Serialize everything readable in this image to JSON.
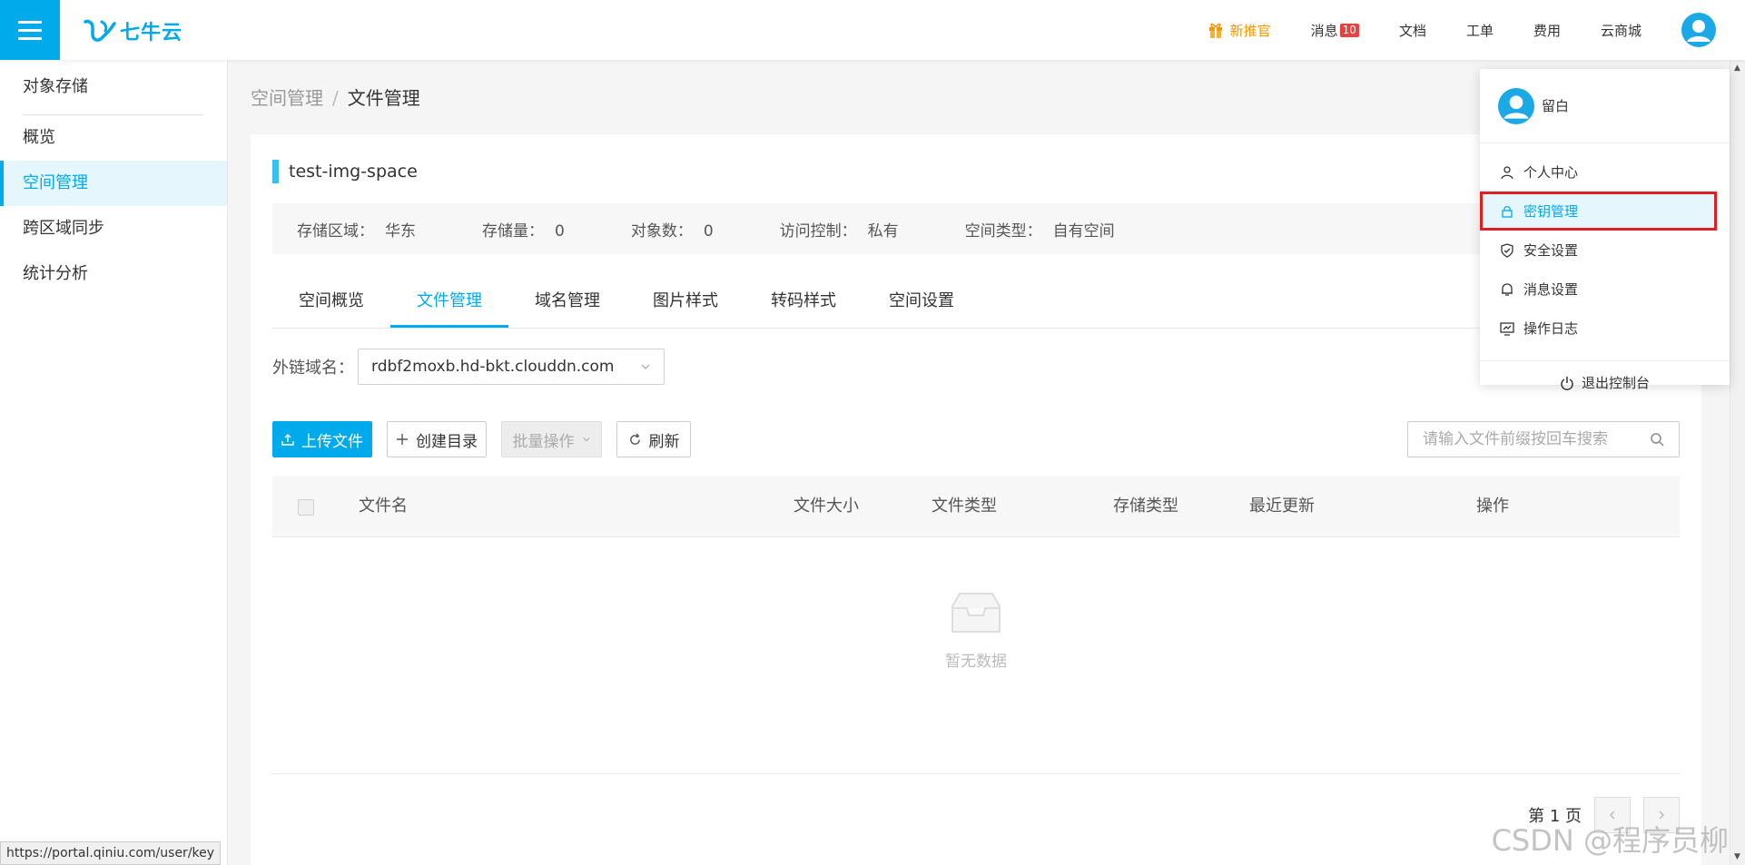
{
  "brand": {
    "name": "七牛云"
  },
  "topnav": {
    "promo": "新推官",
    "messages": "消息",
    "message_count": "10",
    "docs": "文档",
    "ticket": "工单",
    "billing": "费用",
    "market": "云商城"
  },
  "sidebar": {
    "title": "对象存储",
    "items": [
      {
        "label": "概览"
      },
      {
        "label": "空间管理"
      },
      {
        "label": "跨区域同步"
      },
      {
        "label": "统计分析"
      }
    ]
  },
  "breadcrumb": {
    "parent": "空间管理",
    "separator": "/",
    "current": "文件管理"
  },
  "bucket": {
    "name": "test-img-space",
    "info": [
      {
        "key": "存储区域：",
        "value": "华东"
      },
      {
        "key": "存储量：",
        "value": "0"
      },
      {
        "key": "对象数：",
        "value": "0"
      },
      {
        "key": "访问控制：",
        "value": "私有"
      },
      {
        "key": "空间类型：",
        "value": "自有空间"
      }
    ]
  },
  "tabs": [
    "空间概览",
    "文件管理",
    "域名管理",
    "图片样式",
    "转码样式",
    "空间设置"
  ],
  "domain": {
    "label": "外链域名：",
    "value": "rdbf2moxb.hd-bkt.clouddn.com"
  },
  "toolbar": {
    "upload": "上传文件",
    "mkdir": "创建目录",
    "batch": "批量操作",
    "refresh": "刷新",
    "search_placeholder": "请输入文件前缀按回车搜索"
  },
  "table": {
    "columns": [
      "文件名",
      "文件大小",
      "文件类型",
      "存储类型",
      "最近更新",
      "操作"
    ],
    "empty_text": "暂无数据"
  },
  "pager": {
    "label": "第 1 页"
  },
  "dropdown": {
    "username": "留白",
    "items": [
      {
        "label": "个人中心",
        "icon": "user-icon"
      },
      {
        "label": "密钥管理",
        "icon": "lock-icon"
      },
      {
        "label": "安全设置",
        "icon": "shield-icon"
      },
      {
        "label": "消息设置",
        "icon": "bell-icon"
      },
      {
        "label": "操作日志",
        "icon": "log-icon"
      }
    ],
    "logout": "退出控制台"
  },
  "statusbar": {
    "url": "https://portal.qiniu.com/user/key"
  },
  "watermark": "CSDN @程序员柳",
  "colors": {
    "accent": "#00aaeb",
    "highlight_border": "#e02020",
    "promo": "#f39800",
    "badge": "#e64340"
  }
}
